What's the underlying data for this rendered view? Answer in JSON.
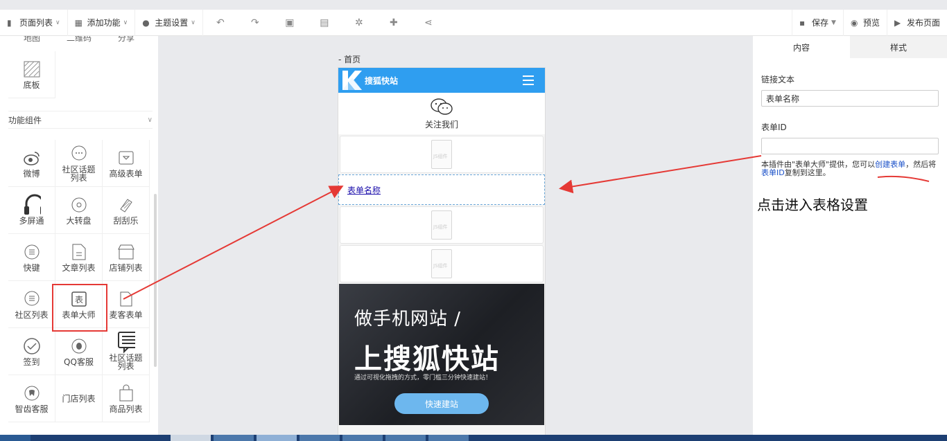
{
  "toolbar": {
    "page_list": "页面列表",
    "add_feature": "添加功能",
    "theme_settings": "主题设置",
    "save": "保存",
    "preview": "预览",
    "publish": "发布页面"
  },
  "left_panel": {
    "partial_row": [
      "地图",
      "二维码",
      "分享"
    ],
    "base_items": [
      {
        "label": "底板",
        "icon": "texture-icon"
      }
    ],
    "section_title": "功能组件",
    "components": [
      {
        "label": "微博",
        "icon": "weibo-icon"
      },
      {
        "label": "社区话题列表",
        "icon": "chat-bubble-icon"
      },
      {
        "label": "高级表单",
        "icon": "form-advanced-icon"
      },
      {
        "label": "多屏通",
        "icon": "headset-icon"
      },
      {
        "label": "大转盘",
        "icon": "wheel-icon"
      },
      {
        "label": "刮刮乐",
        "icon": "scratch-icon"
      },
      {
        "label": "快键",
        "icon": "list-circle-icon"
      },
      {
        "label": "文章列表",
        "icon": "document-icon"
      },
      {
        "label": "店铺列表",
        "icon": "store-icon"
      },
      {
        "label": "社区列表",
        "icon": "community-icon"
      },
      {
        "label": "表单大师",
        "icon": "form-master-icon"
      },
      {
        "label": "麦客表单",
        "icon": "page-icon"
      },
      {
        "label": "签到",
        "icon": "check-circle-icon"
      },
      {
        "label": "QQ客服",
        "icon": "qq-icon"
      },
      {
        "label": "社区话题列表",
        "icon": "topic-list-icon"
      },
      {
        "label": "智齿客服",
        "icon": "tooth-icon"
      },
      {
        "label": "门店列表",
        "icon": "shop-icon"
      },
      {
        "label": "商品列表",
        "icon": "bag-icon"
      }
    ]
  },
  "center": {
    "page_label": "- 首页",
    "site_title": "搜狐快站",
    "follow_label": "关注我们",
    "js_label": "JS组件",
    "form_link_text": "表单名称",
    "banner": {
      "line1": "做手机网站 /",
      "line2": "上搜狐快站",
      "line3": "通过可视化拖拽的方式，零门槛三分钟快速建站！",
      "button": "快速建站"
    }
  },
  "right_panel": {
    "tab_content": "内容",
    "tab_style": "样式",
    "link_text_label": "链接文本",
    "link_text_value": "表单名称",
    "form_id_label": "表单ID",
    "form_id_value": "",
    "hint_prefix": "本插件由\"表单大师\"提供，您可以",
    "hint_link": "创建表单",
    "hint_middle": "，然后将",
    "hint_link2": "表单ID",
    "hint_suffix": "复制到这里。",
    "annotation": "点击进入表格设置"
  }
}
